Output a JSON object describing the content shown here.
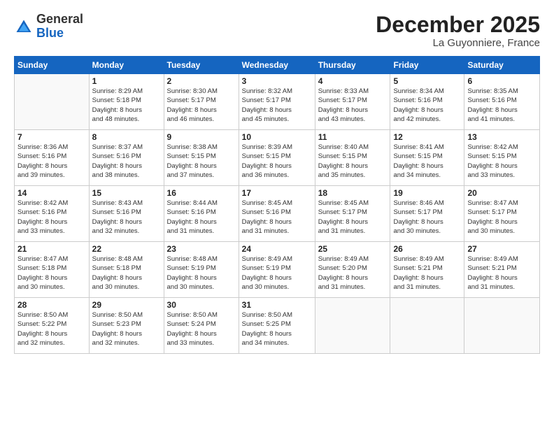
{
  "header": {
    "logo": {
      "general": "General",
      "blue": "Blue"
    },
    "title": "December 2025",
    "location": "La Guyonniere, France"
  },
  "weekdays": [
    "Sunday",
    "Monday",
    "Tuesday",
    "Wednesday",
    "Thursday",
    "Friday",
    "Saturday"
  ],
  "weeks": [
    [
      {
        "day": "",
        "info": ""
      },
      {
        "day": "1",
        "info": "Sunrise: 8:29 AM\nSunset: 5:18 PM\nDaylight: 8 hours\nand 48 minutes."
      },
      {
        "day": "2",
        "info": "Sunrise: 8:30 AM\nSunset: 5:17 PM\nDaylight: 8 hours\nand 46 minutes."
      },
      {
        "day": "3",
        "info": "Sunrise: 8:32 AM\nSunset: 5:17 PM\nDaylight: 8 hours\nand 45 minutes."
      },
      {
        "day": "4",
        "info": "Sunrise: 8:33 AM\nSunset: 5:17 PM\nDaylight: 8 hours\nand 43 minutes."
      },
      {
        "day": "5",
        "info": "Sunrise: 8:34 AM\nSunset: 5:16 PM\nDaylight: 8 hours\nand 42 minutes."
      },
      {
        "day": "6",
        "info": "Sunrise: 8:35 AM\nSunset: 5:16 PM\nDaylight: 8 hours\nand 41 minutes."
      }
    ],
    [
      {
        "day": "7",
        "info": "Sunrise: 8:36 AM\nSunset: 5:16 PM\nDaylight: 8 hours\nand 39 minutes."
      },
      {
        "day": "8",
        "info": "Sunrise: 8:37 AM\nSunset: 5:16 PM\nDaylight: 8 hours\nand 38 minutes."
      },
      {
        "day": "9",
        "info": "Sunrise: 8:38 AM\nSunset: 5:15 PM\nDaylight: 8 hours\nand 37 minutes."
      },
      {
        "day": "10",
        "info": "Sunrise: 8:39 AM\nSunset: 5:15 PM\nDaylight: 8 hours\nand 36 minutes."
      },
      {
        "day": "11",
        "info": "Sunrise: 8:40 AM\nSunset: 5:15 PM\nDaylight: 8 hours\nand 35 minutes."
      },
      {
        "day": "12",
        "info": "Sunrise: 8:41 AM\nSunset: 5:15 PM\nDaylight: 8 hours\nand 34 minutes."
      },
      {
        "day": "13",
        "info": "Sunrise: 8:42 AM\nSunset: 5:15 PM\nDaylight: 8 hours\nand 33 minutes."
      }
    ],
    [
      {
        "day": "14",
        "info": "Sunrise: 8:42 AM\nSunset: 5:16 PM\nDaylight: 8 hours\nand 33 minutes."
      },
      {
        "day": "15",
        "info": "Sunrise: 8:43 AM\nSunset: 5:16 PM\nDaylight: 8 hours\nand 32 minutes."
      },
      {
        "day": "16",
        "info": "Sunrise: 8:44 AM\nSunset: 5:16 PM\nDaylight: 8 hours\nand 31 minutes."
      },
      {
        "day": "17",
        "info": "Sunrise: 8:45 AM\nSunset: 5:16 PM\nDaylight: 8 hours\nand 31 minutes."
      },
      {
        "day": "18",
        "info": "Sunrise: 8:45 AM\nSunset: 5:17 PM\nDaylight: 8 hours\nand 31 minutes."
      },
      {
        "day": "19",
        "info": "Sunrise: 8:46 AM\nSunset: 5:17 PM\nDaylight: 8 hours\nand 30 minutes."
      },
      {
        "day": "20",
        "info": "Sunrise: 8:47 AM\nSunset: 5:17 PM\nDaylight: 8 hours\nand 30 minutes."
      }
    ],
    [
      {
        "day": "21",
        "info": "Sunrise: 8:47 AM\nSunset: 5:18 PM\nDaylight: 8 hours\nand 30 minutes."
      },
      {
        "day": "22",
        "info": "Sunrise: 8:48 AM\nSunset: 5:18 PM\nDaylight: 8 hours\nand 30 minutes."
      },
      {
        "day": "23",
        "info": "Sunrise: 8:48 AM\nSunset: 5:19 PM\nDaylight: 8 hours\nand 30 minutes."
      },
      {
        "day": "24",
        "info": "Sunrise: 8:49 AM\nSunset: 5:19 PM\nDaylight: 8 hours\nand 30 minutes."
      },
      {
        "day": "25",
        "info": "Sunrise: 8:49 AM\nSunset: 5:20 PM\nDaylight: 8 hours\nand 31 minutes."
      },
      {
        "day": "26",
        "info": "Sunrise: 8:49 AM\nSunset: 5:21 PM\nDaylight: 8 hours\nand 31 minutes."
      },
      {
        "day": "27",
        "info": "Sunrise: 8:49 AM\nSunset: 5:21 PM\nDaylight: 8 hours\nand 31 minutes."
      }
    ],
    [
      {
        "day": "28",
        "info": "Sunrise: 8:50 AM\nSunset: 5:22 PM\nDaylight: 8 hours\nand 32 minutes."
      },
      {
        "day": "29",
        "info": "Sunrise: 8:50 AM\nSunset: 5:23 PM\nDaylight: 8 hours\nand 32 minutes."
      },
      {
        "day": "30",
        "info": "Sunrise: 8:50 AM\nSunset: 5:24 PM\nDaylight: 8 hours\nand 33 minutes."
      },
      {
        "day": "31",
        "info": "Sunrise: 8:50 AM\nSunset: 5:25 PM\nDaylight: 8 hours\nand 34 minutes."
      },
      {
        "day": "",
        "info": ""
      },
      {
        "day": "",
        "info": ""
      },
      {
        "day": "",
        "info": ""
      }
    ]
  ]
}
